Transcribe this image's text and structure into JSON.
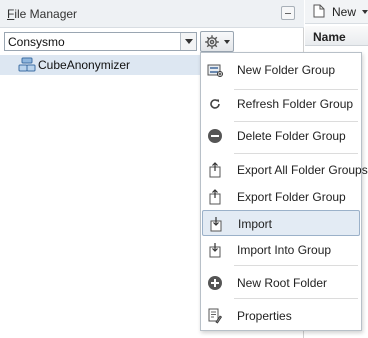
{
  "left_panel": {
    "title_underlined": "F",
    "title_rest": "ile Manager",
    "select_value": "Consysmo",
    "tree_item": "CubeAnonymizer"
  },
  "right_panel": {
    "new_label": "New",
    "column_header": "Name",
    "cut_text_1": "eA",
    "cut_text_2": "ys"
  },
  "menu": {
    "items": [
      {
        "label": "New Folder Group",
        "icon": "new-folder-group-icon"
      },
      {
        "label": "Refresh Folder Group",
        "icon": "refresh-icon"
      },
      {
        "label": "Delete Folder Group",
        "icon": "delete-icon"
      },
      {
        "label": "Export All Folder Groups",
        "icon": "export-icon"
      },
      {
        "label": "Export Folder Group",
        "icon": "export-icon"
      },
      {
        "label": "Import",
        "icon": "import-icon"
      },
      {
        "label": "Import Into Group",
        "icon": "import-icon"
      },
      {
        "label": "New Root Folder",
        "icon": "add-icon"
      },
      {
        "label": "Properties",
        "icon": "properties-icon"
      }
    ],
    "active_index": 5
  }
}
